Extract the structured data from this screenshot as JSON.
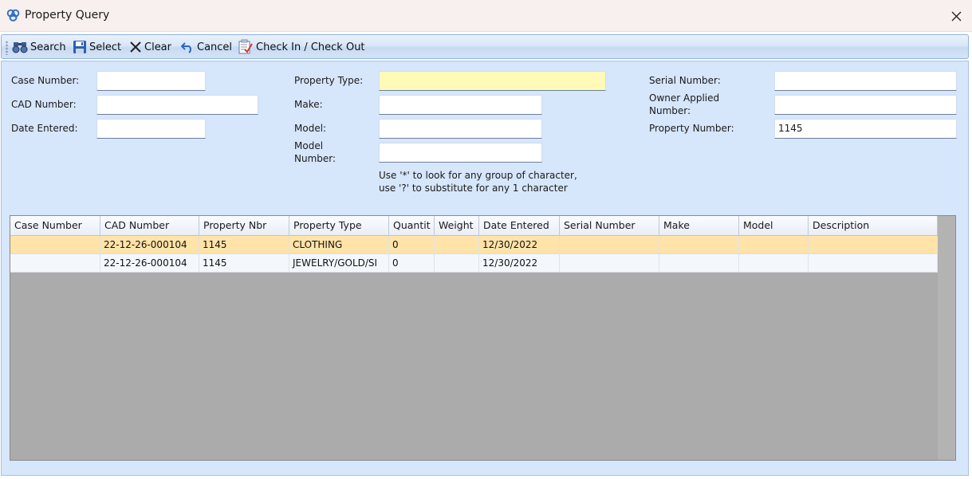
{
  "window": {
    "title": "Property Query",
    "icon": "app-logo-icon",
    "close_icon": "close-icon"
  },
  "toolbar": {
    "search_label": "Search",
    "select_label": "Select",
    "clear_label": "Clear",
    "cancel_label": "Cancel",
    "checkin_label": "Check In / Check Out"
  },
  "form": {
    "case_number": {
      "label": "Case Number:",
      "value": ""
    },
    "cad_number": {
      "label": "CAD Number:",
      "value": ""
    },
    "date_entered": {
      "label": "Date Entered:",
      "value": ""
    },
    "property_type": {
      "label": "Property Type:",
      "value": ""
    },
    "make": {
      "label": "Make:",
      "value": ""
    },
    "model": {
      "label": "Model:",
      "value": ""
    },
    "model_number": {
      "label_line1": "Model",
      "label_line2": "Number:",
      "value": ""
    },
    "serial_number": {
      "label": "Serial Number:",
      "value": ""
    },
    "owner_applied_number": {
      "label_line1": "Owner Applied",
      "label_line2": "Number:",
      "value": ""
    },
    "property_number": {
      "label": "Property Number:",
      "value": "1145"
    },
    "hint_line1": "Use '*' to look for any group of character,",
    "hint_line2": "use '?' to substitute for any 1 character"
  },
  "grid": {
    "columns": [
      "Case Number",
      "CAD Number",
      "Property Nbr",
      "Property Type",
      "Quantit",
      "Weight",
      "Date Entered",
      "Serial Number",
      "Make",
      "Model",
      "Description"
    ],
    "rows": [
      [
        "",
        "22-12-26-000104",
        "1145",
        "CLOTHING",
        "0",
        "",
        "12/30/2022",
        "",
        "",
        "",
        ""
      ],
      [
        "",
        "22-12-26-000104",
        "1145",
        "JEWELRY/GOLD/SI",
        "0",
        "",
        "12/30/2022",
        "",
        "",
        "",
        ""
      ]
    ],
    "selected_row": 0
  },
  "colors": {
    "panel_bg": "#d6e6fb",
    "selected_row": "#ffe3a8",
    "required_field": "#fffab8",
    "grid_empty": "#ababab"
  }
}
